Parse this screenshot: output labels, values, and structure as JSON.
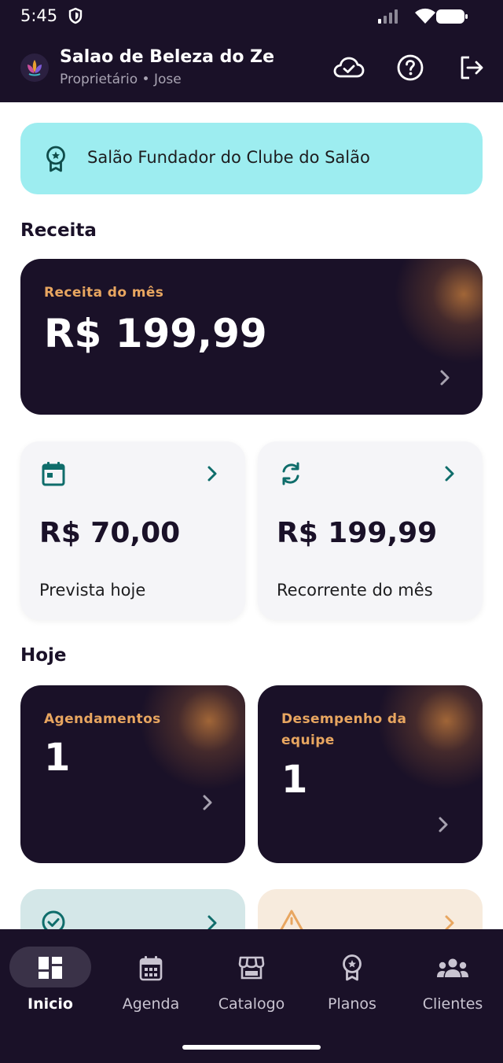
{
  "status_bar": {
    "time": "5:45"
  },
  "header": {
    "salon_name": "Salao de Beleza do Ze",
    "role": "Proprietário",
    "separator": "•",
    "user": "Jose"
  },
  "banner": {
    "text": "Salão Fundador do Clube do Salão"
  },
  "sections": {
    "revenue": "Receita",
    "today": "Hoje"
  },
  "revenue_card": {
    "label": "Receita do mês",
    "value": "R$ 199,99"
  },
  "stat_cards": [
    {
      "icon": "calendar-icon",
      "value": "R$ 70,00",
      "label": "Prevista hoje"
    },
    {
      "icon": "sync-icon",
      "value": "R$ 199,99",
      "label": "Recorrente do mês"
    }
  ],
  "today_cards": [
    {
      "label": "Agendamentos",
      "value": "1"
    },
    {
      "label": "Desempenho da equipe",
      "value": "1"
    }
  ],
  "nav": {
    "items": [
      {
        "label": "Inicio",
        "icon": "dashboard-icon",
        "active": true
      },
      {
        "label": "Agenda",
        "icon": "calendar-icon",
        "active": false
      },
      {
        "label": "Catalogo",
        "icon": "store-icon",
        "active": false
      },
      {
        "label": "Planos",
        "icon": "award-icon",
        "active": false
      },
      {
        "label": "Clientes",
        "icon": "group-icon",
        "active": false
      }
    ]
  },
  "colors": {
    "dark": "#1a1128",
    "accent_orange": "#e8a660",
    "teal": "#0f6d6b",
    "banner": "#9dedf0"
  }
}
